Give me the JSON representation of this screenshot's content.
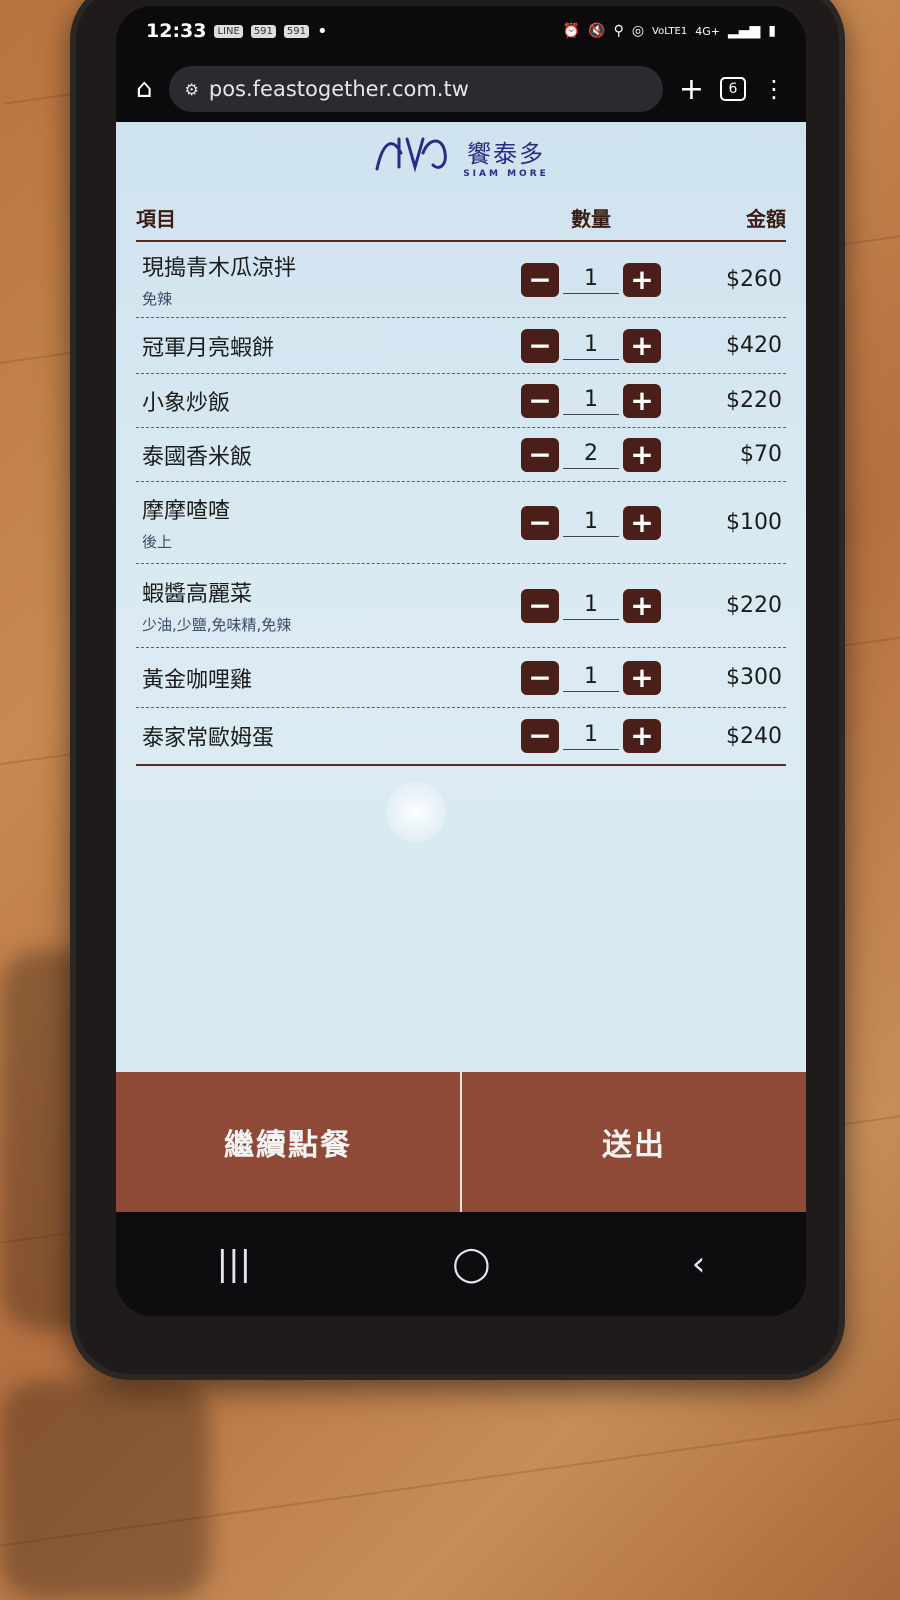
{
  "status_bar": {
    "time": "12:33",
    "badges": [
      "591",
      "591"
    ],
    "network": "4G+",
    "carrier": "VoLTE1"
  },
  "browser": {
    "url": "pos.feastogether.com.tw",
    "tabs_count": "6"
  },
  "logo": {
    "cn": "饗泰多",
    "en": "SIAM MORE",
    "mark": "SIAM MORE"
  },
  "table": {
    "headers": {
      "item": "項目",
      "qty": "數量",
      "amount": "金額"
    },
    "rows": [
      {
        "name": "現搗青木瓜涼拌",
        "note": "免辣",
        "qty": "1",
        "amount": "$260"
      },
      {
        "name": "冠軍月亮蝦餅",
        "note": "",
        "qty": "1",
        "amount": "$420"
      },
      {
        "name": "小象炒飯",
        "note": "",
        "qty": "1",
        "amount": "$220"
      },
      {
        "name": "泰國香米飯",
        "note": "",
        "qty": "2",
        "amount": "$70"
      },
      {
        "name": "摩摩喳喳",
        "note": "後上",
        "qty": "1",
        "amount": "$100"
      },
      {
        "name": "蝦醬高麗菜",
        "note": "少油,少鹽,免味精,免辣",
        "qty": "1",
        "amount": "$220"
      },
      {
        "name": "黃金咖哩雞",
        "note": "",
        "qty": "1",
        "amount": "$300"
      },
      {
        "name": "泰家常歐姆蛋",
        "note": "",
        "qty": "1",
        "amount": "$240"
      }
    ]
  },
  "actions": {
    "continue_label": "繼續點餐",
    "submit_label": "送出"
  },
  "icons": {
    "minus": "minus-icon",
    "plus": "plus-icon",
    "home": "home-icon",
    "more": "more-vert-icon",
    "recent": "recent-apps-icon",
    "home_nav": "home-nav-icon",
    "back": "back-icon"
  },
  "colors": {
    "stepper_bg": "#4a1f1a",
    "action_bg": "#8e4a36",
    "logo": "#2c2a86"
  }
}
